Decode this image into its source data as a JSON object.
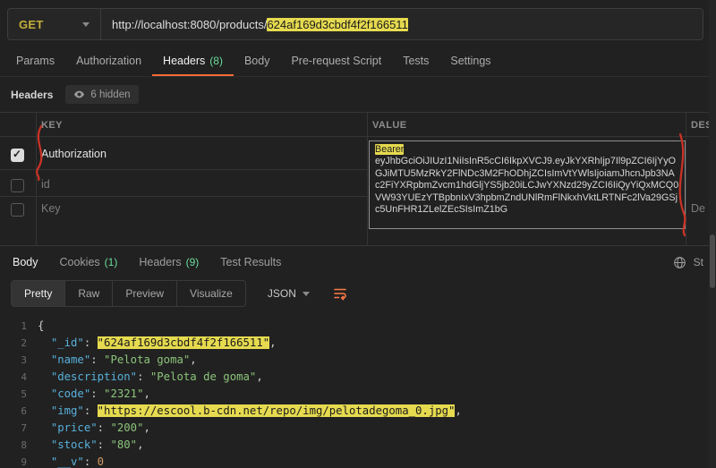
{
  "request": {
    "method": "GET",
    "url_prefix": "http://localhost:8080/products/",
    "url_highlight": "624af169d3cbdf4f2f166511",
    "tabs": [
      {
        "label": "Params"
      },
      {
        "label": "Authorization"
      },
      {
        "label": "Headers",
        "count": "(8)"
      },
      {
        "label": "Body"
      },
      {
        "label": "Pre-request Script"
      },
      {
        "label": "Tests"
      },
      {
        "label": "Settings"
      }
    ]
  },
  "headers_panel": {
    "title": "Headers",
    "hidden_badge": "6 hidden",
    "columns": [
      "KEY",
      "VALUE",
      "DES"
    ],
    "rows": [
      {
        "key": "Authorization",
        "checked": true,
        "value_prefix": "Bearer",
        "token": "eyJhbGciOiJIUzI1NiIsInR5cCI6IkpXVCJ9.eyJkYXRhIjp7Il9pZCI6IjYyOGJiMTU5MzRkY2FlNDc3M2FhODhjZCIsImVtYWlsIjoiamJhcnJpb3NAc2FiYXRpbmZvcm1hdGljYS5jb20iLCJwYXNzd29yZCI6IiQyYiQxMCQ0VW93YUEzYTBpbnIxV3hpbmZndUNlRmFlNkxhVktLRTNFc2lVa29GSjc5UnFHR1ZLelZEcSIsImZ1bG"
      },
      {
        "key": "id",
        "checked": false
      },
      {
        "key": "Key",
        "checked": false,
        "description_placeholder": "De"
      }
    ]
  },
  "response": {
    "tabs": [
      {
        "label": "Body"
      },
      {
        "label": "Cookies",
        "count": "(1)"
      },
      {
        "label": "Headers",
        "count": "(9)"
      },
      {
        "label": "Test Results"
      }
    ],
    "status_partial": "St",
    "view_tabs": [
      "Pretty",
      "Raw",
      "Preview",
      "Visualize"
    ],
    "format": "JSON"
  },
  "response_body": {
    "lines": [
      {
        "n": "1",
        "segs": [
          [
            "p",
            "{"
          ]
        ]
      },
      {
        "n": "2",
        "segs": [
          [
            "p",
            "  "
          ],
          [
            "k",
            "\"_id\""
          ],
          [
            "p",
            ": "
          ],
          [
            "hl",
            "\"624af169d3cbdf4f2f166511\""
          ],
          [
            "p",
            ","
          ]
        ]
      },
      {
        "n": "3",
        "segs": [
          [
            "p",
            "  "
          ],
          [
            "k",
            "\"name\""
          ],
          [
            "p",
            ": "
          ],
          [
            "s",
            "\"Pelota goma\""
          ],
          [
            "p",
            ","
          ]
        ]
      },
      {
        "n": "4",
        "segs": [
          [
            "p",
            "  "
          ],
          [
            "k",
            "\"description\""
          ],
          [
            "p",
            ": "
          ],
          [
            "s",
            "\"Pelota de goma\""
          ],
          [
            "p",
            ","
          ]
        ]
      },
      {
        "n": "5",
        "segs": [
          [
            "p",
            "  "
          ],
          [
            "k",
            "\"code\""
          ],
          [
            "p",
            ": "
          ],
          [
            "s",
            "\"2321\""
          ],
          [
            "p",
            ","
          ]
        ]
      },
      {
        "n": "6",
        "segs": [
          [
            "p",
            "  "
          ],
          [
            "k",
            "\"img\""
          ],
          [
            "p",
            ": "
          ],
          [
            "hl",
            "\"https://escool.b-cdn.net/repo/img/pelotadegoma_0.jpg\""
          ],
          [
            "p",
            ","
          ]
        ]
      },
      {
        "n": "7",
        "segs": [
          [
            "p",
            "  "
          ],
          [
            "k",
            "\"price\""
          ],
          [
            "p",
            ": "
          ],
          [
            "s",
            "\"200\""
          ],
          [
            "p",
            ","
          ]
        ]
      },
      {
        "n": "8",
        "segs": [
          [
            "p",
            "  "
          ],
          [
            "k",
            "\"stock\""
          ],
          [
            "p",
            ": "
          ],
          [
            "s",
            "\"80\""
          ],
          [
            "p",
            ","
          ]
        ]
      },
      {
        "n": "9",
        "segs": [
          [
            "p",
            "  "
          ],
          [
            "k",
            "\"__v\""
          ],
          [
            "p",
            ": "
          ],
          [
            "n2",
            "0"
          ]
        ]
      }
    ]
  }
}
